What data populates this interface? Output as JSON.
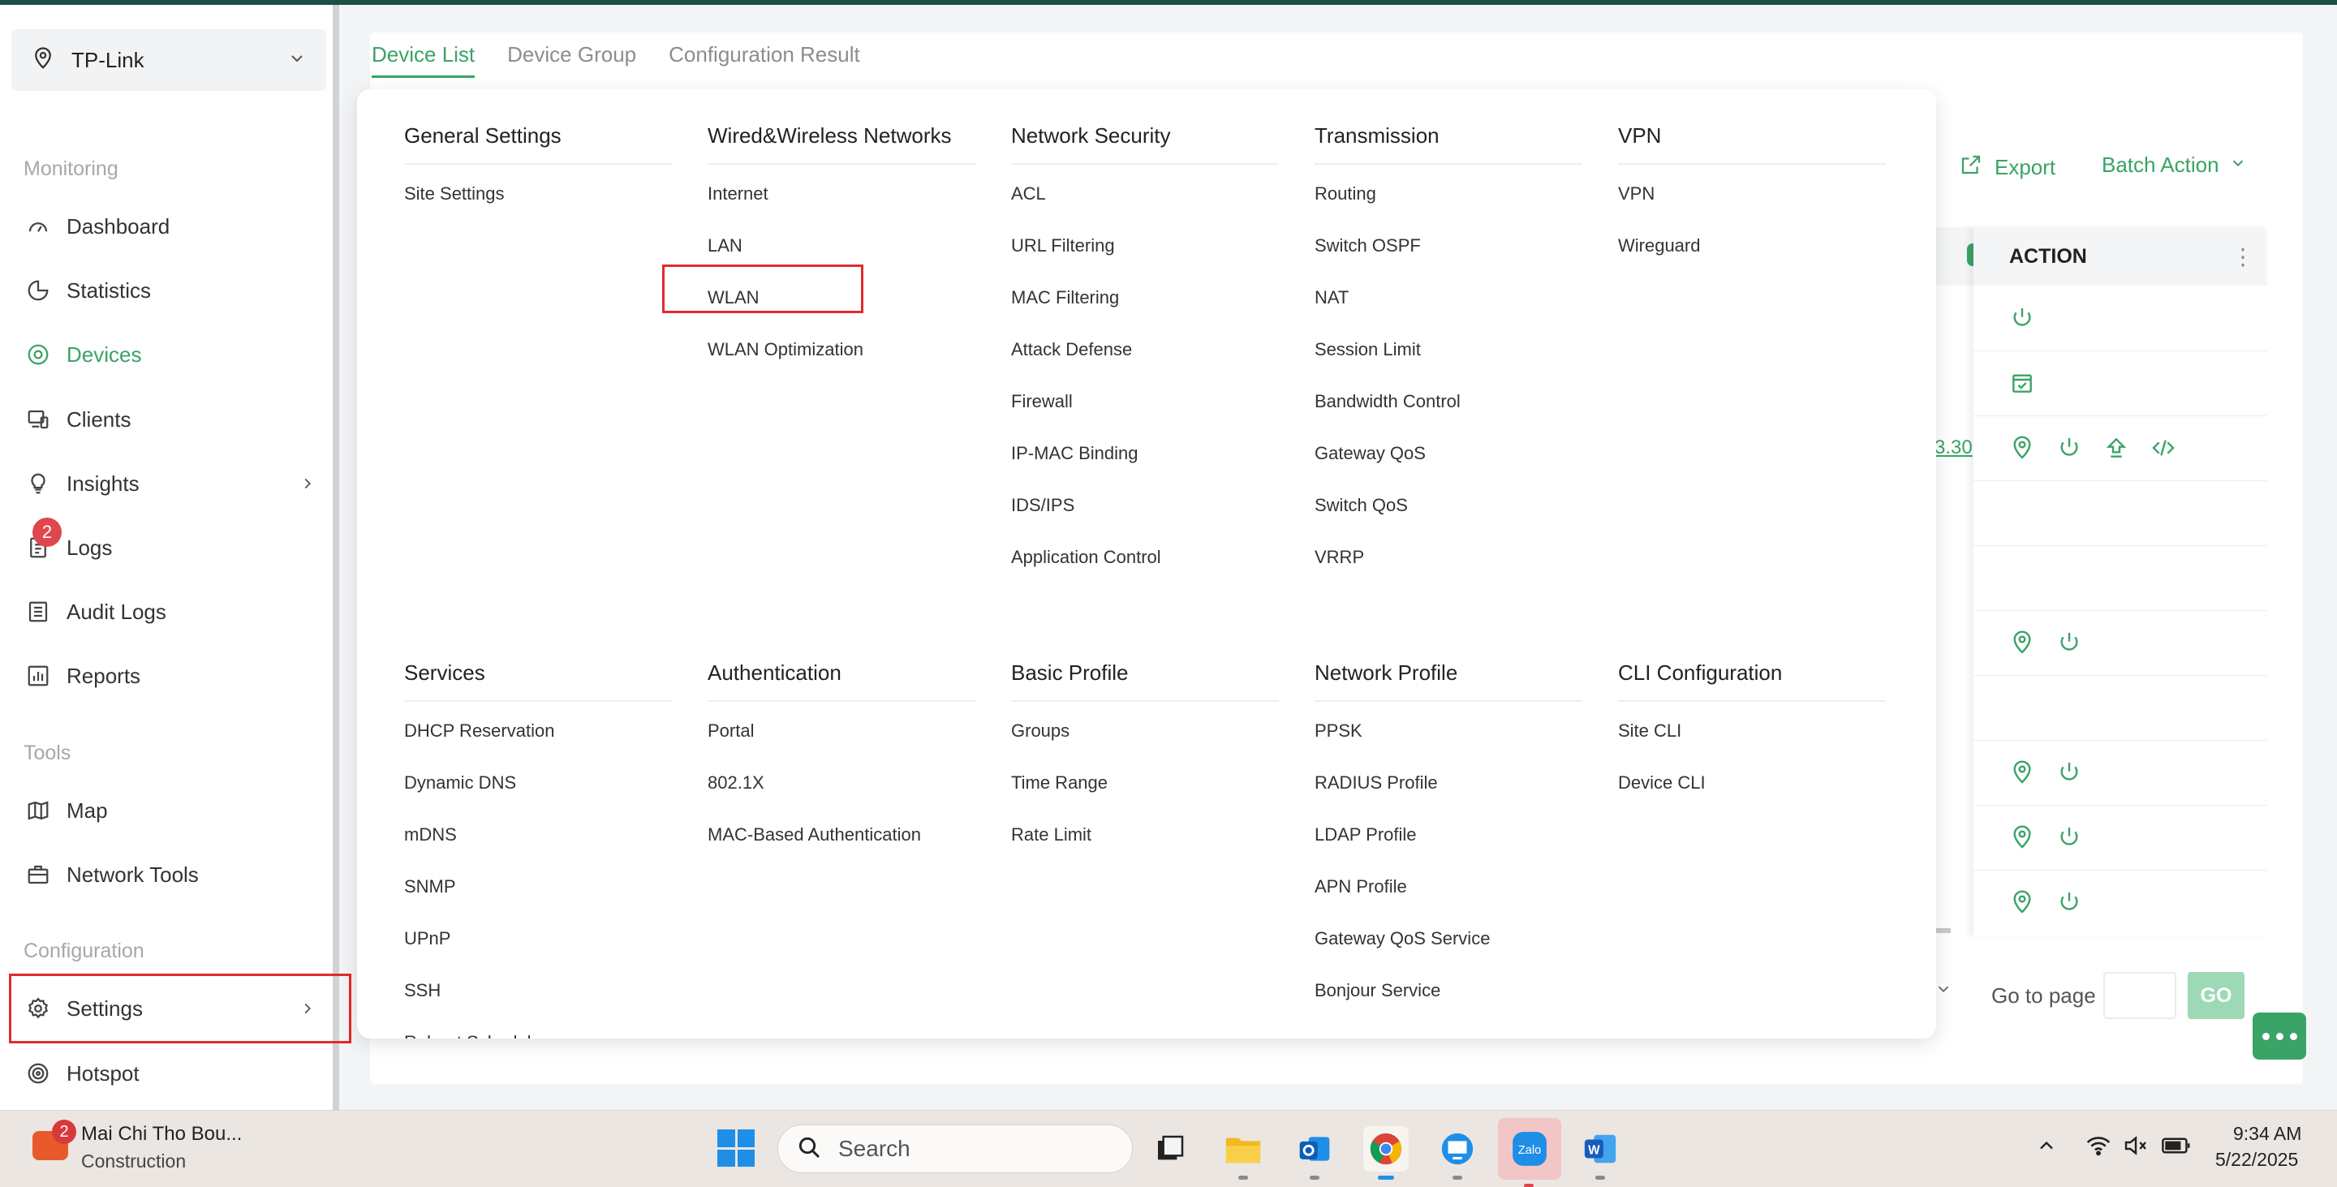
{
  "site_selector": {
    "label": "TP-Link"
  },
  "sidebar": {
    "sections": {
      "monitoring": "Monitoring",
      "tools": "Tools",
      "configuration": "Configuration"
    },
    "items": [
      {
        "label": "Dashboard"
      },
      {
        "label": "Statistics"
      },
      {
        "label": "Devices"
      },
      {
        "label": "Clients"
      },
      {
        "label": "Insights"
      },
      {
        "label": "Logs",
        "badge": "2"
      },
      {
        "label": "Audit Logs"
      },
      {
        "label": "Reports"
      },
      {
        "label": "Map"
      },
      {
        "label": "Network Tools"
      },
      {
        "label": "Settings"
      },
      {
        "label": "Hotspot"
      }
    ]
  },
  "tabs": [
    {
      "label": "Device List"
    },
    {
      "label": "Device Group"
    },
    {
      "label": "Configuration Result"
    }
  ],
  "toolbar": {
    "export_label": "Export",
    "batch_label": "Batch Action"
  },
  "table": {
    "action_header": "ACTION",
    "ip_fragment": "3.30"
  },
  "pagination": {
    "goto_label": "Go to page",
    "go_label": "GO"
  },
  "dropdown": {
    "columns": [
      {
        "title": "General Settings",
        "items": [
          "Site Settings"
        ]
      },
      {
        "title": "Wired&Wireless Networks",
        "items": [
          "Internet",
          "LAN",
          "WLAN",
          "WLAN Optimization"
        ]
      },
      {
        "title": "Network Security",
        "items": [
          "ACL",
          "URL Filtering",
          "MAC Filtering",
          "Attack Defense",
          "Firewall",
          "IP-MAC Binding",
          "IDS/IPS",
          "Application Control"
        ]
      },
      {
        "title": "Transmission",
        "items": [
          "Routing",
          "Switch OSPF",
          "NAT",
          "Session Limit",
          "Bandwidth Control",
          "Gateway QoS",
          "Switch QoS",
          "VRRP"
        ]
      },
      {
        "title": "VPN",
        "items": [
          "VPN",
          "Wireguard"
        ]
      },
      {
        "title": "Services",
        "items": [
          "DHCP Reservation",
          "Dynamic DNS",
          "mDNS",
          "SNMP",
          "UPnP",
          "SSH",
          "Reboot Schedule"
        ]
      },
      {
        "title": "Authentication",
        "items": [
          "Portal",
          "802.1X",
          "MAC-Based Authentication"
        ]
      },
      {
        "title": "Basic Profile",
        "items": [
          "Groups",
          "Time Range",
          "Rate Limit"
        ]
      },
      {
        "title": "Network Profile",
        "items": [
          "PPSK",
          "RADIUS Profile",
          "LDAP Profile",
          "APN Profile",
          "Gateway QoS Service",
          "Bonjour Service"
        ]
      },
      {
        "title": "CLI Configuration",
        "items": [
          "Site CLI",
          "Device CLI"
        ]
      }
    ]
  },
  "taskbar": {
    "notify_badge": "2",
    "app_name": "Mai Chi Tho Bou...",
    "app_sub": "Construction",
    "search_label": "Search",
    "time": "9:34 AM",
    "date": "5/22/2025"
  },
  "colors": {
    "accent": "#3aa366",
    "highlight": "#e22b2b",
    "topbar": "#1f4e46"
  }
}
